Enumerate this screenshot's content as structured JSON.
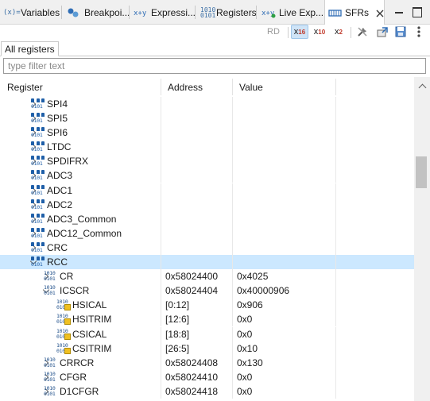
{
  "tabs": [
    {
      "label": "Variables",
      "icon": "(x)="
    },
    {
      "label": "Breakpoi...",
      "icon": "breakpoints"
    },
    {
      "label": "Expressi...",
      "icon": "expressions"
    },
    {
      "label": "Registers",
      "icon": "1010 0101"
    },
    {
      "label": "Live Exp...",
      "icon": "live-expressions"
    },
    {
      "label": "SFRs",
      "icon": "sfr"
    }
  ],
  "toolbar": {
    "rd": "RD",
    "hex_base": "x",
    "hex_sub": "16",
    "dec_base": "x",
    "dec_sub": "10",
    "bin_base": "x",
    "bin_sub": "2"
  },
  "subtab": "All registers",
  "filter": {
    "placeholder": "type filter text",
    "value": ""
  },
  "columns": {
    "register": "Register",
    "address": "Address",
    "value": "Value"
  },
  "rows": [
    {
      "name": "SPI4",
      "address": "",
      "value": "",
      "level": 0,
      "kind": "peripheral",
      "expander": "closed"
    },
    {
      "name": "SPI5",
      "address": "",
      "value": "",
      "level": 0,
      "kind": "peripheral",
      "expander": "closed"
    },
    {
      "name": "SPI6",
      "address": "",
      "value": "",
      "level": 0,
      "kind": "peripheral",
      "expander": "closed"
    },
    {
      "name": "LTDC",
      "address": "",
      "value": "",
      "level": 0,
      "kind": "peripheral",
      "expander": "closed"
    },
    {
      "name": "SPDIFRX",
      "address": "",
      "value": "",
      "level": 0,
      "kind": "peripheral",
      "expander": "closed"
    },
    {
      "name": "ADC3",
      "address": "",
      "value": "",
      "level": 0,
      "kind": "peripheral",
      "expander": "closed"
    },
    {
      "name": "ADC1",
      "address": "",
      "value": "",
      "level": 0,
      "kind": "peripheral",
      "expander": "closed"
    },
    {
      "name": "ADC2",
      "address": "",
      "value": "",
      "level": 0,
      "kind": "peripheral",
      "expander": "closed"
    },
    {
      "name": "ADC3_Common",
      "address": "",
      "value": "",
      "level": 0,
      "kind": "peripheral",
      "expander": "closed"
    },
    {
      "name": "ADC12_Common",
      "address": "",
      "value": "",
      "level": 0,
      "kind": "peripheral",
      "expander": "closed"
    },
    {
      "name": "CRC",
      "address": "",
      "value": "",
      "level": 0,
      "kind": "peripheral",
      "expander": "closed"
    },
    {
      "name": "RCC",
      "address": "",
      "value": "",
      "level": 0,
      "kind": "peripheral",
      "expander": "open",
      "selected": true
    },
    {
      "name": "CR",
      "address": "0x58024400",
      "value": "0x4025",
      "level": 1,
      "kind": "register",
      "expander": "closed"
    },
    {
      "name": "ICSCR",
      "address": "0x58024404",
      "value": "0x40000906",
      "level": 1,
      "kind": "register",
      "expander": "open"
    },
    {
      "name": "HSICAL",
      "address": "[0:12]",
      "value": "0x906",
      "level": 2,
      "kind": "field",
      "expander": "none"
    },
    {
      "name": "HSITRIM",
      "address": "[12:6]",
      "value": "0x0",
      "level": 2,
      "kind": "field",
      "expander": "none"
    },
    {
      "name": "CSICAL",
      "address": "[18:8]",
      "value": "0x0",
      "level": 2,
      "kind": "field",
      "expander": "none"
    },
    {
      "name": "CSITRIM",
      "address": "[26:5]",
      "value": "0x10",
      "level": 2,
      "kind": "field",
      "expander": "none"
    },
    {
      "name": "CRRCR",
      "address": "0x58024408",
      "value": "0x130",
      "level": 1,
      "kind": "register",
      "expander": "closed"
    },
    {
      "name": "CFGR",
      "address": "0x58024410",
      "value": "0x0",
      "level": 1,
      "kind": "register",
      "expander": "closed"
    },
    {
      "name": "D1CFGR",
      "address": "0x58024418",
      "value": "0x0",
      "level": 1,
      "kind": "register",
      "expander": "closed"
    }
  ],
  "colors": {
    "selection": "#cce8ff",
    "accent": "#1f5fa8"
  }
}
